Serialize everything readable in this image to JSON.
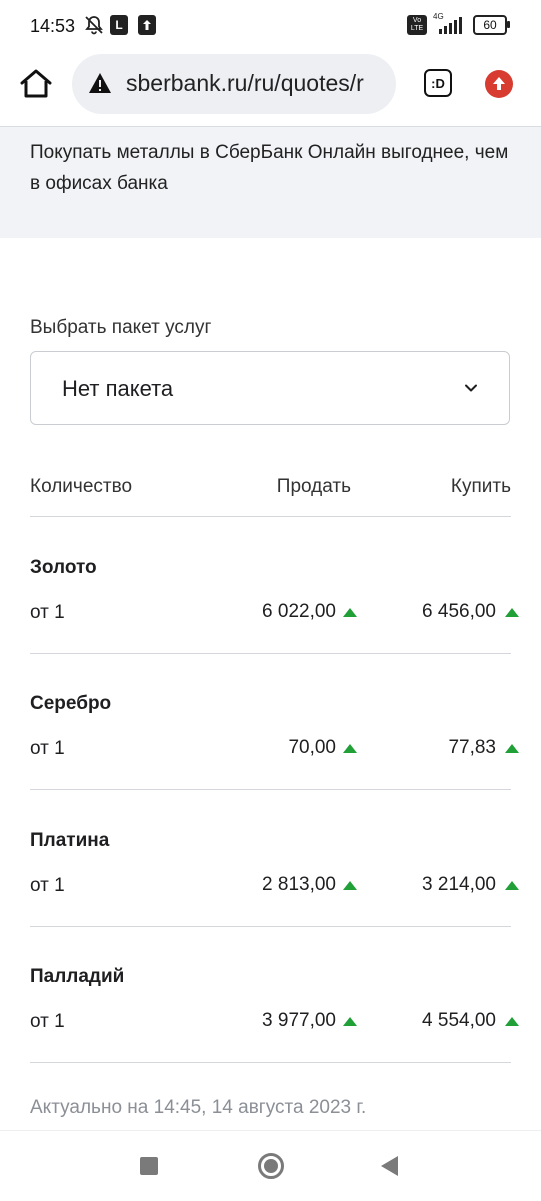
{
  "status": {
    "time": "14:53",
    "icons": [
      "bell-off-icon",
      "l-badge-icon",
      "upload-icon",
      "volte-icon",
      "signal-icon"
    ],
    "volte": "Vo LTE",
    "network": "4G",
    "battery": "60"
  },
  "browser": {
    "url": "sberbank.ru/ru/quotes/r",
    "tab_label": ":D",
    "icons": [
      "home-icon",
      "warning-icon",
      "tab-switcher-icon",
      "update-icon"
    ]
  },
  "banner": {
    "text": "Покупать металлы в СберБанк Онлайн выгоднее, чем в офисах банка"
  },
  "package": {
    "label": "Выбрать пакет услуг",
    "selected": "Нет пакета"
  },
  "table": {
    "headers": {
      "quantity": "Количество",
      "sell": "Продать",
      "buy": "Купить"
    },
    "metals": [
      {
        "name": "Золото",
        "qty": "от 1",
        "sell": "6 022,00",
        "buy": "6 456,00"
      },
      {
        "name": "Серебро",
        "qty": "от 1",
        "sell": "70,00",
        "buy": "77,83"
      },
      {
        "name": "Платина",
        "qty": "от 1",
        "sell": "2 813,00",
        "buy": "3 214,00"
      },
      {
        "name": "Палладий",
        "qty": "от 1",
        "sell": "3 977,00",
        "buy": "4 554,00"
      }
    ]
  },
  "updated": "Актуально на 14:45, 14 августа 2023 г.",
  "colors": {
    "accent_green": "#21a038",
    "update_red": "#d83b2f",
    "banner_bg": "#f1f3f7"
  }
}
